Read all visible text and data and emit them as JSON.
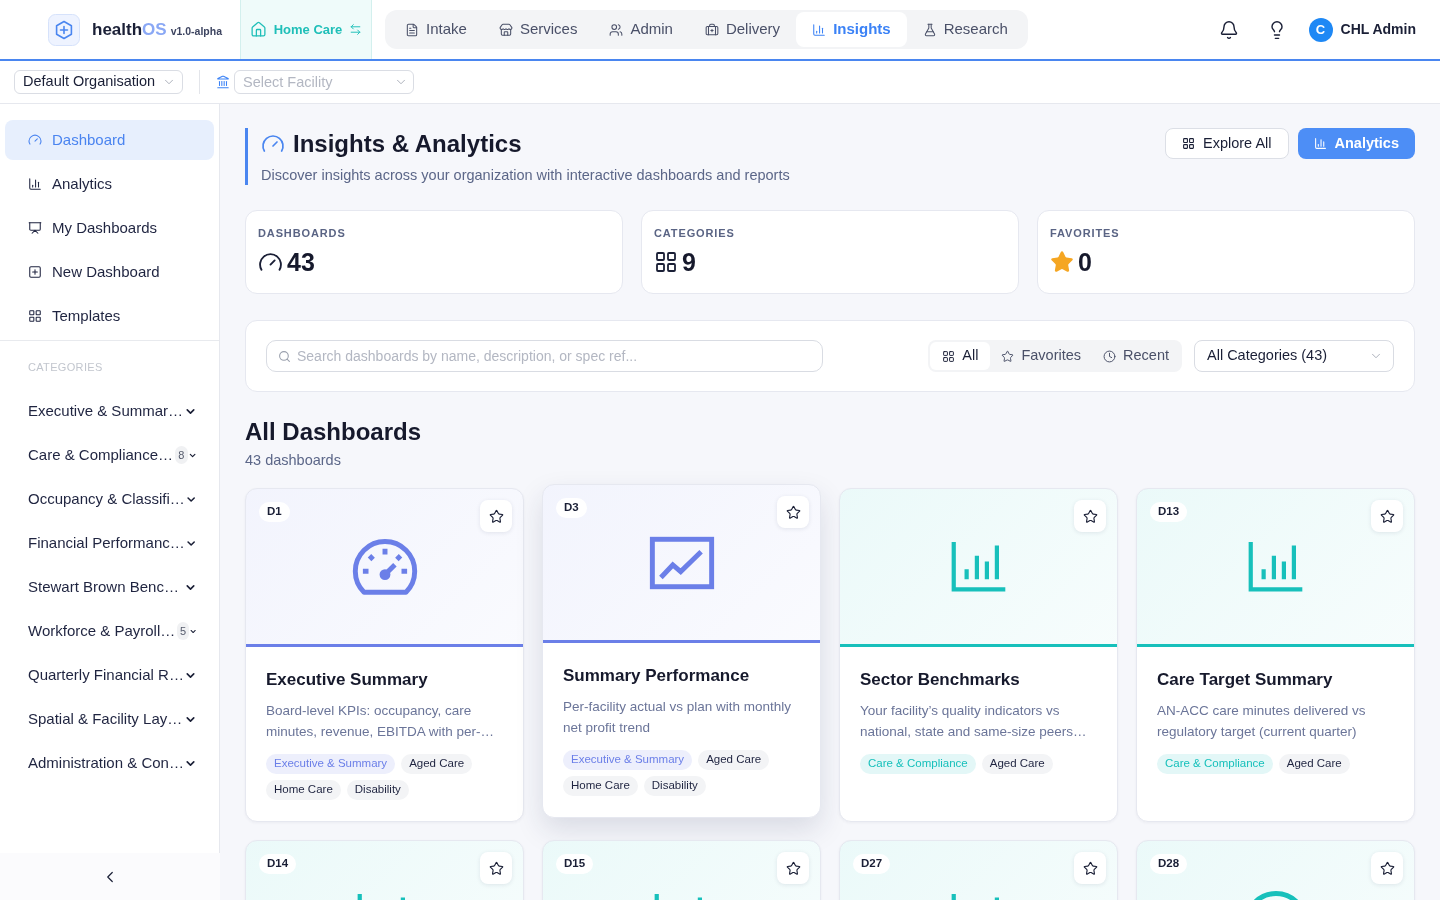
{
  "header": {
    "brand": {
      "name": "health",
      "accent": "OS",
      "version": "v1.0-alpha"
    },
    "context": {
      "label": "Home Care"
    },
    "modules": [
      {
        "label": "Intake",
        "selected": false
      },
      {
        "label": "Services",
        "selected": false
      },
      {
        "label": "Admin",
        "selected": false
      },
      {
        "label": "Delivery",
        "selected": false
      },
      {
        "label": "Insights",
        "selected": true
      },
      {
        "label": "Research",
        "selected": false
      }
    ],
    "user": {
      "initial": "C",
      "name": "CHL Admin"
    }
  },
  "toolbar": {
    "organisation": {
      "value": "Default Organisation"
    },
    "facility": {
      "placeholder": "Select Facility"
    }
  },
  "sidebar": {
    "items": [
      {
        "label": "Dashboard",
        "selected": true
      },
      {
        "label": "Analytics",
        "selected": false
      },
      {
        "label": "My Dashboards",
        "selected": false
      },
      {
        "label": "New Dashboard",
        "selected": false
      },
      {
        "label": "Templates",
        "selected": false
      }
    ],
    "categories_heading": "CATEGORIES",
    "categories": [
      {
        "label": "Executive & Summar…",
        "expanded": false
      },
      {
        "label": "Care & Compliance…",
        "count": "8",
        "expanded": false
      },
      {
        "label": "Occupancy & Classifi…",
        "expanded": false
      },
      {
        "label": "Financial Performanc…",
        "expanded": false
      },
      {
        "label": "Stewart Brown Benc…",
        "expanded": false
      },
      {
        "label": "Workforce & Payroll…",
        "count": "5",
        "expanded": false
      },
      {
        "label": "Quarterly Financial R…",
        "expanded": false
      },
      {
        "label": "Spatial & Facility Lay…",
        "expanded": false
      },
      {
        "label": "Administration & Con…",
        "expanded": false
      }
    ]
  },
  "page": {
    "title": "Insights & Analytics",
    "subtitle": "Discover insights across your organization with interactive dashboards and reports",
    "actions": [
      {
        "label": "Explore All",
        "kind": "outline"
      },
      {
        "label": "Analytics",
        "kind": "primary"
      }
    ]
  },
  "stats": [
    {
      "label": "DASHBOARDS",
      "value": "43",
      "kind": "dashboards"
    },
    {
      "label": "CATEGORIES",
      "value": "9",
      "kind": "categories"
    },
    {
      "label": "FAVORITES",
      "value": "0",
      "kind": "favorites"
    }
  ],
  "filters": {
    "search": {
      "placeholder": "Search dashboards by name, description, or spec ref..."
    },
    "views": [
      {
        "label": "All",
        "selected": true
      },
      {
        "label": "Favorites",
        "selected": false
      },
      {
        "label": "Recent",
        "selected": false
      }
    ],
    "category": {
      "value": "All Categories (43)"
    }
  },
  "section": {
    "title": "All Dashboards",
    "count": "43 dashboards"
  },
  "cards": [
    {
      "code": "D1",
      "kind": "gauge",
      "color": "#6b7fe8",
      "favorite": false,
      "hovered": false,
      "title": "Executive Summary",
      "description": "Board-level KPIs: occupancy, care minutes, revenue, EBITDA with per-…",
      "tags": [
        {
          "label": "Executive & Summary",
          "kind": "category"
        },
        {
          "label": "Aged Care",
          "kind": "sector"
        },
        {
          "label": "Home Care",
          "kind": "sector"
        },
        {
          "label": "Disability",
          "kind": "sector"
        }
      ]
    },
    {
      "code": "D3",
      "kind": "trend",
      "color": "#6b7fe8",
      "favorite": false,
      "hovered": true,
      "title": "Summary Performance",
      "description": "Per-facility actual vs plan with monthly net profit trend",
      "tags": [
        {
          "label": "Executive & Summary",
          "kind": "category"
        },
        {
          "label": "Aged Care",
          "kind": "sector"
        },
        {
          "label": "Home Care",
          "kind": "sector"
        },
        {
          "label": "Disability",
          "kind": "sector"
        }
      ]
    },
    {
      "kind": "bars",
      "color": "#17c0bb",
      "favorite": false,
      "hovered": false,
      "title": "Sector Benchmarks",
      "description": "Your facility’s quality indicators vs national, state and same-size peers…",
      "tags": [
        {
          "label": "Care & Compliance",
          "kind": "category"
        },
        {
          "label": "Aged Care",
          "kind": "sector"
        }
      ]
    },
    {
      "code": "D13",
      "kind": "bars",
      "color": "#17c0bb",
      "favorite": false,
      "hovered": false,
      "title": "Care Target Summary",
      "description": "AN-ACC care minutes delivered vs regulatory target (current quarter)",
      "tags": [
        {
          "label": "Care & Compliance",
          "kind": "category"
        },
        {
          "label": "Aged Care",
          "kind": "sector"
        }
      ]
    },
    {
      "code": "D14",
      "kind": "bars",
      "color": "#17c0bb",
      "favorite": false,
      "hovered": false
    },
    {
      "code": "D15",
      "kind": "bars",
      "color": "#17c0bb",
      "favorite": false,
      "hovered": false
    },
    {
      "code": "D27",
      "kind": "bars",
      "color": "#17c0bb",
      "favorite": false,
      "hovered": false
    },
    {
      "code": "D28",
      "kind": "gauge",
      "color": "#17c0bb",
      "favorite": false,
      "hovered": false
    }
  ]
}
